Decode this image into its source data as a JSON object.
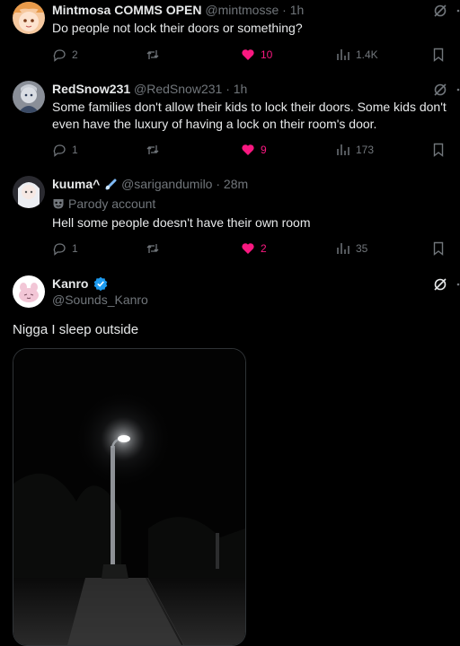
{
  "tweets": [
    {
      "name": "Mintmosa COMMS OPEN",
      "handle": "@mintmosse",
      "sep": "·",
      "time": "1h",
      "text": "Do people not lock their doors or something?",
      "replies": "2",
      "likes": "10",
      "views": "1.4K",
      "liked": true
    },
    {
      "name": "RedSnow231",
      "handle": "@RedSnow231",
      "sep": "·",
      "time": "1h",
      "text_line1": "Some families don't allow their kids to lock their doors. Some kids don't",
      "text_line2": "even have the luxury of having a lock on their room's door.",
      "replies": "1",
      "likes": "9",
      "views": "173",
      "liked": true
    },
    {
      "name": "kuuma^",
      "handle": "@sarigandumilo",
      "sep": "·",
      "time": "28m",
      "label": "Parody account",
      "text": "Hell some people doesn't have their own room",
      "replies": "1",
      "likes": "2",
      "views": "35",
      "liked": true
    },
    {
      "name": "Kanro",
      "handle": "@Sounds_Kanro",
      "text": "Nigga I sleep outside",
      "verified": true
    }
  ],
  "colors": {
    "background": "#000000",
    "text": "#e7e9ea",
    "muted": "#71767b",
    "like": "#f91880",
    "verified": "#1d9bf0"
  },
  "icons": [
    "reply-icon",
    "retweet-icon",
    "heart-icon",
    "views-icon",
    "bookmark-icon",
    "grok-icon",
    "more-icon",
    "verified-badge-icon",
    "parody-mask-icon"
  ]
}
